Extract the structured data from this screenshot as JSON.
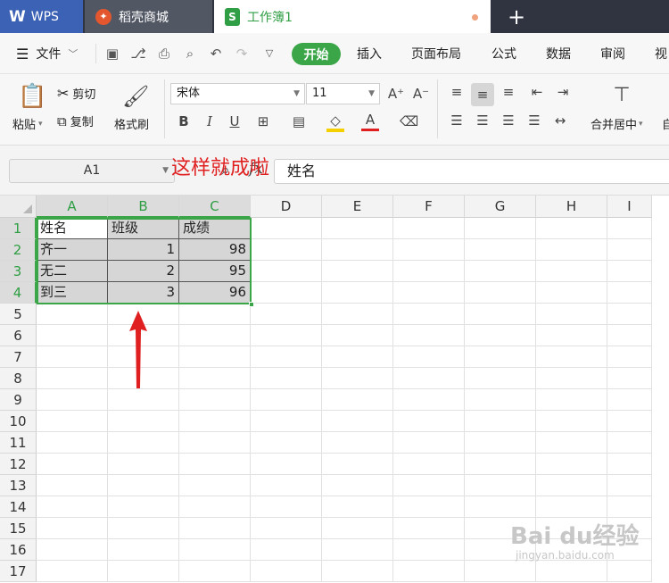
{
  "tabs": {
    "wps_label": "WPS",
    "daoke_label": "稻壳商城",
    "workbook_label": "工作簿1",
    "new_tab_symbol": "+"
  },
  "menu": {
    "file_label": "文件",
    "tabs": [
      "开始",
      "插入",
      "页面布局",
      "公式",
      "数据",
      "审阅",
      "视"
    ],
    "active_color": "#3aa648"
  },
  "ribbon": {
    "paste_label": "粘贴",
    "cut_label": "剪切",
    "copy_label": "复制",
    "format_painter_label": "格式刷",
    "font_name": "宋体",
    "font_size": "11",
    "bold": "B",
    "italic": "I",
    "underline": "U",
    "font_color_letter": "A",
    "merge_center_label": "合并居中",
    "auto_partial": "自",
    "font_color": "#e02020",
    "fill_color": "#f5d000"
  },
  "formula_bar": {
    "cell_ref": "A1",
    "fx": "fx",
    "value": "姓名"
  },
  "sheet": {
    "columns": [
      "A",
      "B",
      "C",
      "D",
      "E",
      "F",
      "G",
      "H",
      "I"
    ],
    "rows": [
      "1",
      "2",
      "3",
      "4",
      "5",
      "6",
      "7",
      "8",
      "9",
      "10",
      "11",
      "12",
      "13",
      "14",
      "15",
      "16",
      "17"
    ],
    "data": [
      [
        "姓名",
        "班级",
        "成绩"
      ],
      [
        "齐一",
        "1",
        "98"
      ],
      [
        "无二",
        "2",
        "95"
      ],
      [
        "到三",
        "3",
        "96"
      ]
    ]
  },
  "annotation": {
    "text": "这样就成啦",
    "color": "#e02020"
  },
  "watermark": {
    "brand": "Bai du经验",
    "url": "jingyan.baidu.com"
  }
}
